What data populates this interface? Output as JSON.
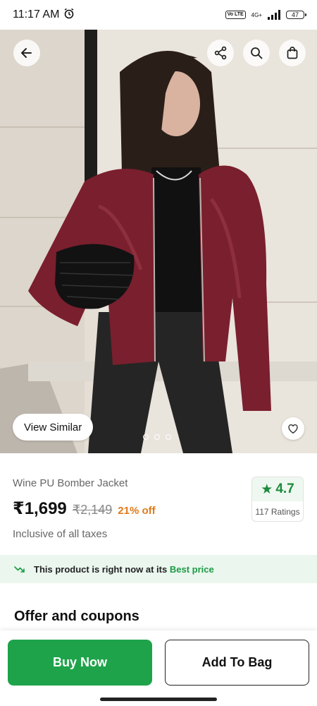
{
  "status": {
    "time": "11:17 AM",
    "network": "4G+",
    "volte": "Vo LTE",
    "battery": "47"
  },
  "header": {
    "back_icon": "back-arrow-icon",
    "share_icon": "share-icon",
    "search_icon": "search-icon",
    "bag_icon": "bag-icon"
  },
  "gallery": {
    "view_similar_label": "View Similar",
    "image_count": 3,
    "active_index": 0
  },
  "product": {
    "name": "Wine PU Bomber Jacket",
    "price": "₹1,699",
    "mrp": "₹2,149",
    "discount": "21% off",
    "tax_note": "Inclusive of all taxes",
    "rating": "4.7",
    "rating_count": "117 Ratings"
  },
  "best_price": {
    "prefix": "This product is right now at its",
    "highlight": "Best price"
  },
  "offers": {
    "title": "Offer and coupons"
  },
  "actions": {
    "buy_now": "Buy Now",
    "add_to_bag": "Add To Bag"
  },
  "colors": {
    "primary_green": "#1ea34a",
    "rating_green": "#1d8a3e",
    "discount_orange": "#e07a1a",
    "jacket_wine": "#7a1f2e"
  }
}
